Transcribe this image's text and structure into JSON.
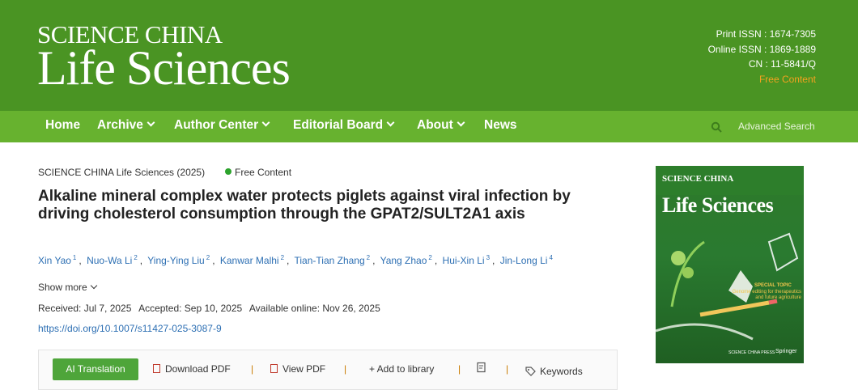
{
  "header": {
    "logo_top": "SCIENCE CHINA",
    "logo_main": "Life Sciences",
    "print_issn": "Print ISSN : 1674-7305",
    "online_issn": "Online ISSN : 1869-1889",
    "cn": "CN : 11-5841/Q",
    "free_content": "Free Content"
  },
  "nav": {
    "items": [
      {
        "label": "Home"
      },
      {
        "label": "Archive"
      },
      {
        "label": "Author Center"
      },
      {
        "label": "Editorial Board"
      },
      {
        "label": "About"
      },
      {
        "label": "News"
      }
    ],
    "advanced_search": "Advanced Search",
    "search_icon": "search-icon"
  },
  "article": {
    "journal_year": "SCIENCE CHINA Life Sciences (2025)",
    "free_tag": "Free Content",
    "title": "Alkaline mineral complex water protects piglets against viral infection by driving cholesterol consumption through the GPAT2/SULT2A1 axis",
    "authors": [
      {
        "name": "Xin Yao",
        "sup": "1"
      },
      {
        "name": "Nuo-Wa Li",
        "sup": "2"
      },
      {
        "name": "Ying-Ying Liu",
        "sup": "2"
      },
      {
        "name": "Kanwar Malhi",
        "sup": "2"
      },
      {
        "name": "Tian-Tian Zhang",
        "sup": "2"
      },
      {
        "name": "Yang Zhao",
        "sup": "2"
      },
      {
        "name": "Hui-Xin Li",
        "sup": "3"
      },
      {
        "name": "Jin-Long Li",
        "sup": "4"
      }
    ],
    "show_more": "Show more",
    "received": "Received: Jul 7, 2025",
    "accepted": "Accepted: Sep 10, 2025",
    "available": "Available online: Nov 26, 2025",
    "doi": "https://doi.org/10.1007/s11427-025-3087-9"
  },
  "toolbar": {
    "ai_translation": "AI Translation",
    "download_pdf": "Download PDF",
    "view_pdf": "View PDF",
    "add_library": "+ Add to library",
    "keywords": "Keywords",
    "separator": "|"
  },
  "cover": {
    "brand": "SCIENCE CHINA",
    "title": "Life Sciences",
    "special_topic": "SPECIAL TOPIC",
    "topic_line1": "Genome editing for therapeutics",
    "topic_line2": "and future agriculture",
    "press": "SCIENCE CHINA PRESS",
    "publisher": "Springer"
  },
  "colors": {
    "header": "#4a9423",
    "nav": "#67b22f",
    "accent": "#f3a21f",
    "link": "#2d6fb3",
    "button": "#4ea53a"
  }
}
